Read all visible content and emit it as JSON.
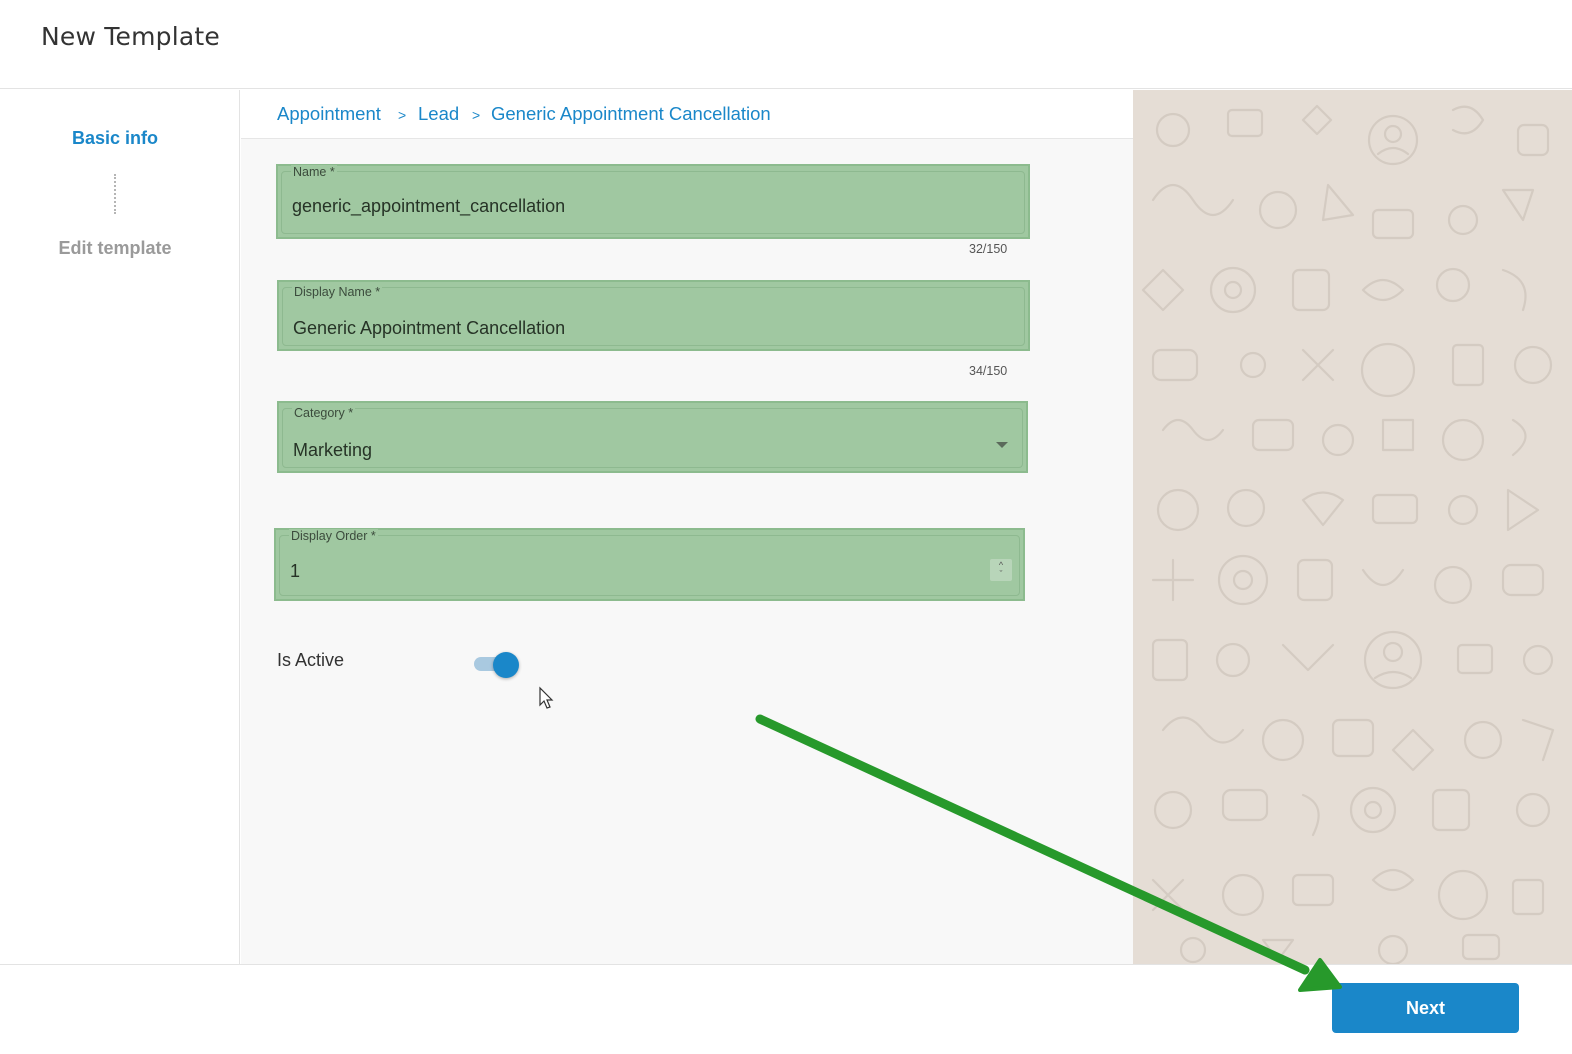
{
  "header": {
    "title": "New Template"
  },
  "sidebar": {
    "steps": [
      {
        "label": "Basic info",
        "state": "active"
      },
      {
        "label": "Edit template",
        "state": "inactive"
      }
    ]
  },
  "breadcrumb": {
    "items": [
      "Appointment",
      "Lead",
      "Generic Appointment Cancellation"
    ],
    "separator": ">"
  },
  "form": {
    "name": {
      "label": "Name *",
      "value": "generic_appointment_cancellation",
      "counter": "32/150"
    },
    "display_name": {
      "label": "Display Name *",
      "value": "Generic Appointment Cancellation",
      "counter": "34/150"
    },
    "category": {
      "label": "Category *",
      "value": "Marketing"
    },
    "display_order": {
      "label": "Display Order *",
      "value": "1"
    },
    "is_active": {
      "label": "Is Active",
      "checked": true
    }
  },
  "footer": {
    "next_label": "Next"
  },
  "colors": {
    "accent": "#1a87c9",
    "field_highlight": "#a0c8a1",
    "annotation_arrow": "#27992b",
    "chat_background": "#e5ddd5"
  }
}
